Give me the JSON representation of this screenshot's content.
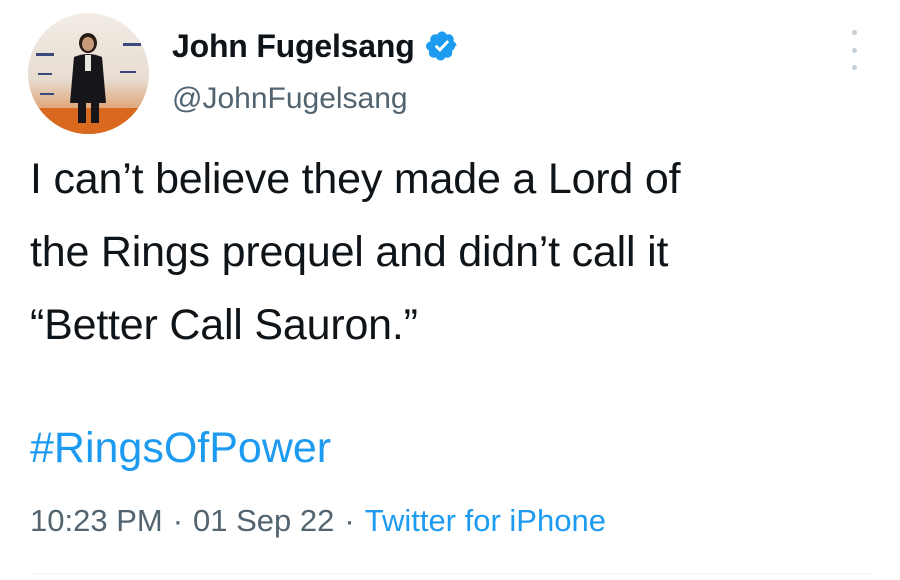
{
  "user": {
    "display_name": "John Fugelsang",
    "handle": "@JohnFugelsang",
    "verified": true,
    "verified_color": "#1d9bf0"
  },
  "tweet": {
    "text_lines": [
      "I can’t believe they made a Lord of",
      "the Rings prequel and didn’t call it",
      "“Better Call Sauron.”"
    ],
    "hashtag": "#RingsOfPower",
    "time": "10:23 PM",
    "date": "01 Sep 22",
    "separator": "·",
    "source": "Twitter for iPhone"
  },
  "icons": {
    "more": "more-vertical-icon",
    "verified": "verified-badge-icon"
  },
  "colors": {
    "text": "#0f1419",
    "secondary": "#536471",
    "link": "#1d9bf0"
  }
}
